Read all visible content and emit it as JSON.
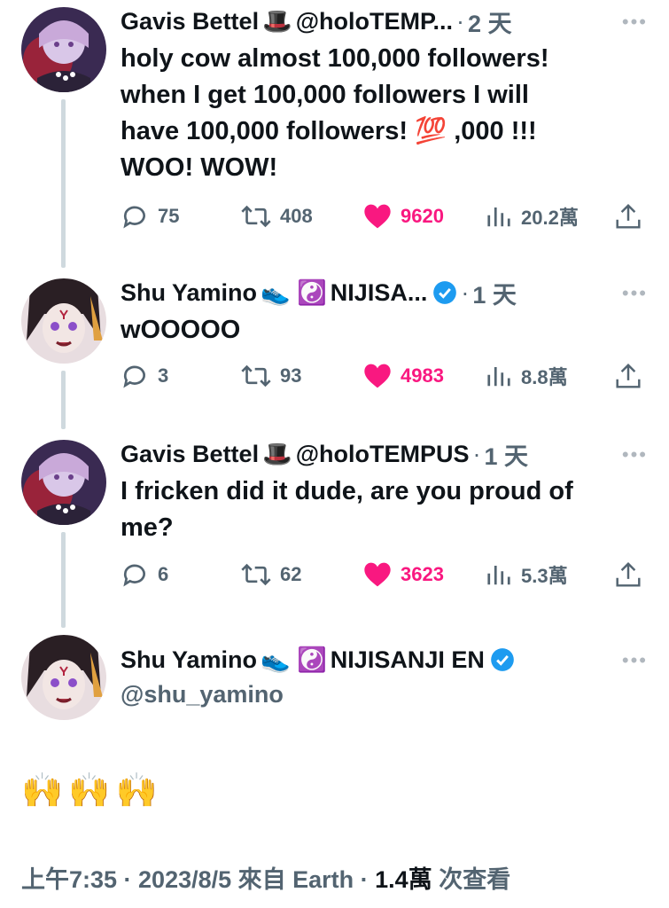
{
  "tweets": [
    {
      "name": "Gavis Bettel",
      "name_emoji": "🎩",
      "handle": "@holoTEMP...",
      "time": "2 天",
      "text_lines": [
        "holy cow almost 100,000 followers!",
        "when I get 100,000 followers I will",
        "have 100,000 followers! 💯 ,000 !!!",
        "WOO! WOW!"
      ],
      "replies": "75",
      "retweets": "408",
      "likes": "9620",
      "views": "20.2萬"
    },
    {
      "name": "Shu Yamino",
      "name_emoji": "👟 ☯️",
      "handle": "NIJISA...",
      "time": "1 天",
      "text_lines": [
        "wOOOOO"
      ],
      "replies": "3",
      "retweets": "93",
      "likes": "4983",
      "views": "8.8萬"
    },
    {
      "name": "Gavis Bettel",
      "name_emoji": "🎩",
      "handle": "@holoTEMPUS",
      "time": "1 天",
      "text_lines": [
        "I fricken did it dude, are you proud of",
        "me?"
      ],
      "replies": "6",
      "retweets": "62",
      "likes": "3623",
      "views": "5.3萬"
    }
  ],
  "main_tweet": {
    "name": "Shu Yamino",
    "name_emoji": "👟 ☯️",
    "org": "NIJISANJI EN",
    "handle": "@shu_yamino",
    "text": "🙌🙌🙌",
    "footer_time": "上午7:35 · 2023/8/5 來自 Earth · ",
    "footer_views": "1.4萬",
    "footer_suffix": " 次查看"
  },
  "more_label": "•••",
  "colors": {
    "like": "#f91880",
    "verified": "#1d9bf0",
    "muted": "#536471",
    "thread": "#cfd9de"
  }
}
